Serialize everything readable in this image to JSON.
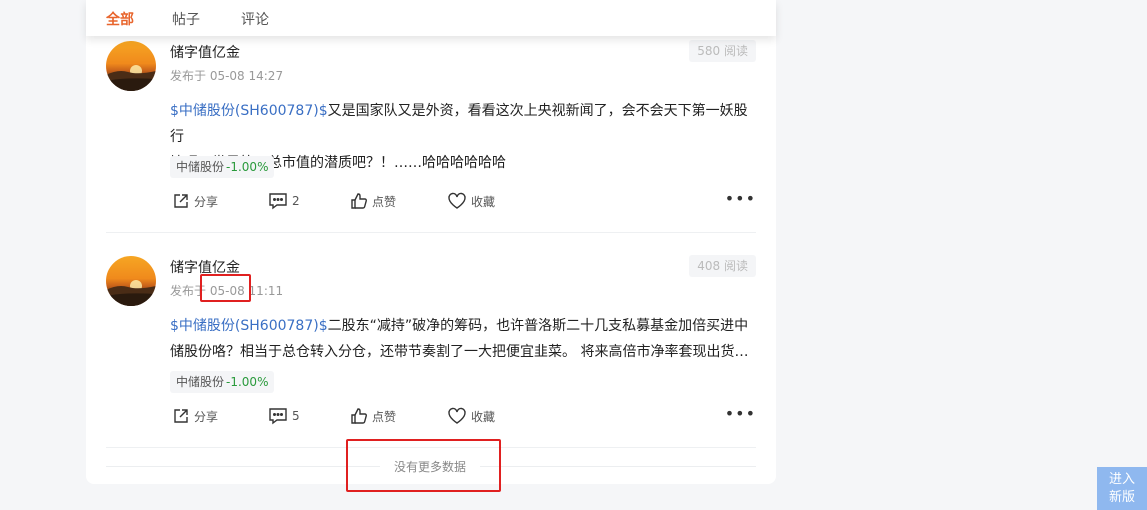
{
  "tabs": [
    {
      "label": "全部"
    },
    {
      "label": "帖子"
    },
    {
      "label": "评论"
    }
  ],
  "posts": [
    {
      "author": "储字值亿金",
      "time": "发布于 05-08 14:27",
      "reads": "580 阅读",
      "stock_link": "$中储股份(SH600787)$",
      "content_line1_rest": "又是国家队又是外资，看看这次上央视新闻了，会不会天下第一妖股行",
      "content_line2": "情呢？世界第一总市值的潜质吧？！……哈哈哈哈哈哈",
      "tag_name": "中储股份",
      "tag_pct": "-1.00%",
      "share_label": "分享",
      "comment_count": "2",
      "like_label": "点赞",
      "fav_label": "收藏"
    },
    {
      "author": "储字值亿金",
      "time_prefix": "发布于",
      "time_date": "05-08",
      "time_clock": "11:11",
      "reads": "408 阅读",
      "stock_link": "$中储股份(SH600787)$",
      "content_line1_rest": "二股东“减持”破净的筹码，也许普洛斯二十几支私募基金加倍买进中",
      "content_line2": "储股份咯？相当于总仓转入分仓，还带节奏割了一大把便宜韭菜。 将来高倍市净率套现出货…",
      "tag_name": "中储股份",
      "tag_pct": "-1.00%",
      "share_label": "分享",
      "comment_count": "5",
      "like_label": "点赞",
      "fav_label": "收藏"
    }
  ],
  "footer": {
    "no_more": "没有更多数据"
  },
  "newver": {
    "line1": "进入",
    "line2": "新版"
  },
  "colors": {
    "accent": "#e8652d",
    "link": "#3a6fc4",
    "down": "#2a9a3c",
    "highlight": "#e02020"
  }
}
